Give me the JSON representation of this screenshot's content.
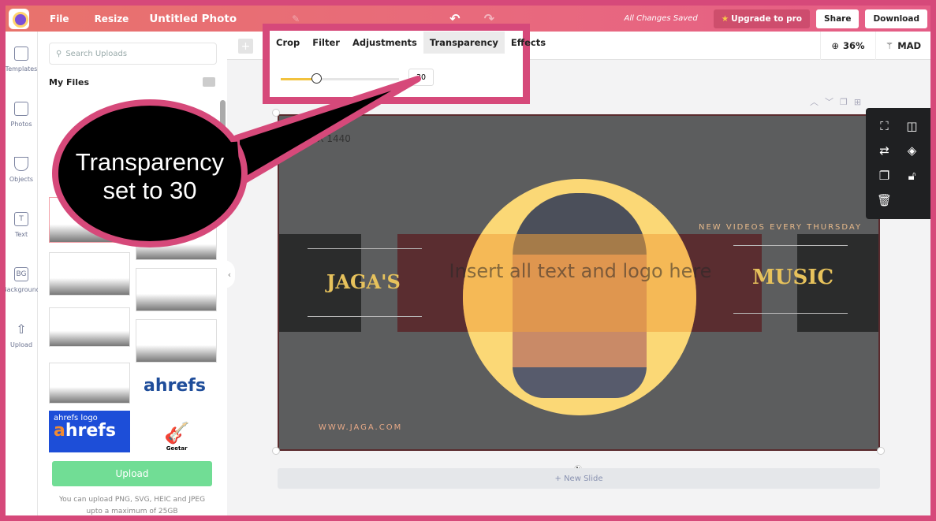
{
  "topbar": {
    "file": "File",
    "resize": "Resize",
    "title": "Untitled Photo",
    "saved": "All Changes Saved",
    "upgrade": "Upgrade to pro",
    "share": "Share",
    "download": "Download"
  },
  "rail": [
    {
      "label": "Templates",
      "icon": "templates-icon"
    },
    {
      "label": "Photos",
      "icon": "photos-icon"
    },
    {
      "label": "Objects",
      "icon": "objects-icon"
    },
    {
      "label": "Text",
      "icon": "text-icon",
      "glyph": "T"
    },
    {
      "label": "Background",
      "icon": "background-icon",
      "glyph": "BG"
    },
    {
      "label": "Upload",
      "icon": "upload-icon",
      "glyph": "⇧"
    }
  ],
  "panel": {
    "search_placeholder": "Search Uploads",
    "heading": "My Files",
    "upload": "Upload",
    "note": "You can upload PNG, SVG, HEIC and JPEG upto a maximum of 25GB",
    "thumb_labels": [
      "ahrefs logo",
      "ahrefs",
      "Geetar"
    ]
  },
  "toolbar": {
    "zoom": "36%",
    "magic": "MAD"
  },
  "image_tools": {
    "tabs": [
      "Crop",
      "Filter",
      "Adjustments",
      "Transparency",
      "Effects"
    ],
    "active": "Transparency",
    "transparency_value": "30",
    "transparency_percent": 30,
    "accent": "#f2c23e"
  },
  "slide": {
    "dims": "2560 X 1440",
    "left_title": "JAGA'S",
    "right_title": "MUSIC",
    "tagline": "NEW VIDEOS EVERY THURSDAY",
    "website": "WWW.JAGA.COM",
    "placeholder": "Insert all text and logo here"
  },
  "new_slide": "+ New Slide",
  "callout": {
    "text_line1": "Transparency",
    "text_line2": "set to 30",
    "border": "#d6497a"
  },
  "colors": {
    "highlight": "#d6497a",
    "upload_btn": "#71dd95"
  }
}
